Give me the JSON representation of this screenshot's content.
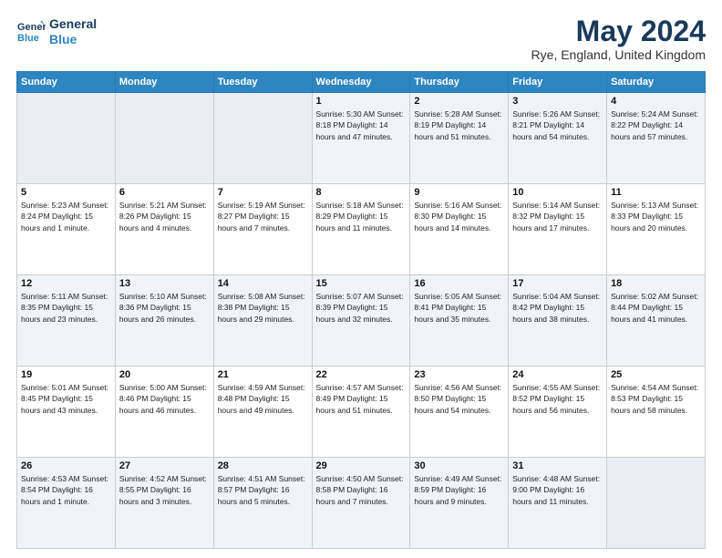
{
  "header": {
    "logo_line1": "General",
    "logo_line2": "Blue",
    "title": "May 2024",
    "location": "Rye, England, United Kingdom"
  },
  "weekdays": [
    "Sunday",
    "Monday",
    "Tuesday",
    "Wednesday",
    "Thursday",
    "Friday",
    "Saturday"
  ],
  "weeks": [
    [
      {
        "day": "",
        "info": ""
      },
      {
        "day": "",
        "info": ""
      },
      {
        "day": "",
        "info": ""
      },
      {
        "day": "1",
        "info": "Sunrise: 5:30 AM\nSunset: 8:18 PM\nDaylight: 14 hours\nand 47 minutes."
      },
      {
        "day": "2",
        "info": "Sunrise: 5:28 AM\nSunset: 8:19 PM\nDaylight: 14 hours\nand 51 minutes."
      },
      {
        "day": "3",
        "info": "Sunrise: 5:26 AM\nSunset: 8:21 PM\nDaylight: 14 hours\nand 54 minutes."
      },
      {
        "day": "4",
        "info": "Sunrise: 5:24 AM\nSunset: 8:22 PM\nDaylight: 14 hours\nand 57 minutes."
      }
    ],
    [
      {
        "day": "5",
        "info": "Sunrise: 5:23 AM\nSunset: 8:24 PM\nDaylight: 15 hours\nand 1 minute."
      },
      {
        "day": "6",
        "info": "Sunrise: 5:21 AM\nSunset: 8:26 PM\nDaylight: 15 hours\nand 4 minutes."
      },
      {
        "day": "7",
        "info": "Sunrise: 5:19 AM\nSunset: 8:27 PM\nDaylight: 15 hours\nand 7 minutes."
      },
      {
        "day": "8",
        "info": "Sunrise: 5:18 AM\nSunset: 8:29 PM\nDaylight: 15 hours\nand 11 minutes."
      },
      {
        "day": "9",
        "info": "Sunrise: 5:16 AM\nSunset: 8:30 PM\nDaylight: 15 hours\nand 14 minutes."
      },
      {
        "day": "10",
        "info": "Sunrise: 5:14 AM\nSunset: 8:32 PM\nDaylight: 15 hours\nand 17 minutes."
      },
      {
        "day": "11",
        "info": "Sunrise: 5:13 AM\nSunset: 8:33 PM\nDaylight: 15 hours\nand 20 minutes."
      }
    ],
    [
      {
        "day": "12",
        "info": "Sunrise: 5:11 AM\nSunset: 8:35 PM\nDaylight: 15 hours\nand 23 minutes."
      },
      {
        "day": "13",
        "info": "Sunrise: 5:10 AM\nSunset: 8:36 PM\nDaylight: 15 hours\nand 26 minutes."
      },
      {
        "day": "14",
        "info": "Sunrise: 5:08 AM\nSunset: 8:38 PM\nDaylight: 15 hours\nand 29 minutes."
      },
      {
        "day": "15",
        "info": "Sunrise: 5:07 AM\nSunset: 8:39 PM\nDaylight: 15 hours\nand 32 minutes."
      },
      {
        "day": "16",
        "info": "Sunrise: 5:05 AM\nSunset: 8:41 PM\nDaylight: 15 hours\nand 35 minutes."
      },
      {
        "day": "17",
        "info": "Sunrise: 5:04 AM\nSunset: 8:42 PM\nDaylight: 15 hours\nand 38 minutes."
      },
      {
        "day": "18",
        "info": "Sunrise: 5:02 AM\nSunset: 8:44 PM\nDaylight: 15 hours\nand 41 minutes."
      }
    ],
    [
      {
        "day": "19",
        "info": "Sunrise: 5:01 AM\nSunset: 8:45 PM\nDaylight: 15 hours\nand 43 minutes."
      },
      {
        "day": "20",
        "info": "Sunrise: 5:00 AM\nSunset: 8:46 PM\nDaylight: 15 hours\nand 46 minutes."
      },
      {
        "day": "21",
        "info": "Sunrise: 4:59 AM\nSunset: 8:48 PM\nDaylight: 15 hours\nand 49 minutes."
      },
      {
        "day": "22",
        "info": "Sunrise: 4:57 AM\nSunset: 8:49 PM\nDaylight: 15 hours\nand 51 minutes."
      },
      {
        "day": "23",
        "info": "Sunrise: 4:56 AM\nSunset: 8:50 PM\nDaylight: 15 hours\nand 54 minutes."
      },
      {
        "day": "24",
        "info": "Sunrise: 4:55 AM\nSunset: 8:52 PM\nDaylight: 15 hours\nand 56 minutes."
      },
      {
        "day": "25",
        "info": "Sunrise: 4:54 AM\nSunset: 8:53 PM\nDaylight: 15 hours\nand 58 minutes."
      }
    ],
    [
      {
        "day": "26",
        "info": "Sunrise: 4:53 AM\nSunset: 8:54 PM\nDaylight: 16 hours\nand 1 minute."
      },
      {
        "day": "27",
        "info": "Sunrise: 4:52 AM\nSunset: 8:55 PM\nDaylight: 16 hours\nand 3 minutes."
      },
      {
        "day": "28",
        "info": "Sunrise: 4:51 AM\nSunset: 8:57 PM\nDaylight: 16 hours\nand 5 minutes."
      },
      {
        "day": "29",
        "info": "Sunrise: 4:50 AM\nSunset: 8:58 PM\nDaylight: 16 hours\nand 7 minutes."
      },
      {
        "day": "30",
        "info": "Sunrise: 4:49 AM\nSunset: 8:59 PM\nDaylight: 16 hours\nand 9 minutes."
      },
      {
        "day": "31",
        "info": "Sunrise: 4:48 AM\nSunset: 9:00 PM\nDaylight: 16 hours\nand 11 minutes."
      },
      {
        "day": "",
        "info": ""
      }
    ]
  ]
}
